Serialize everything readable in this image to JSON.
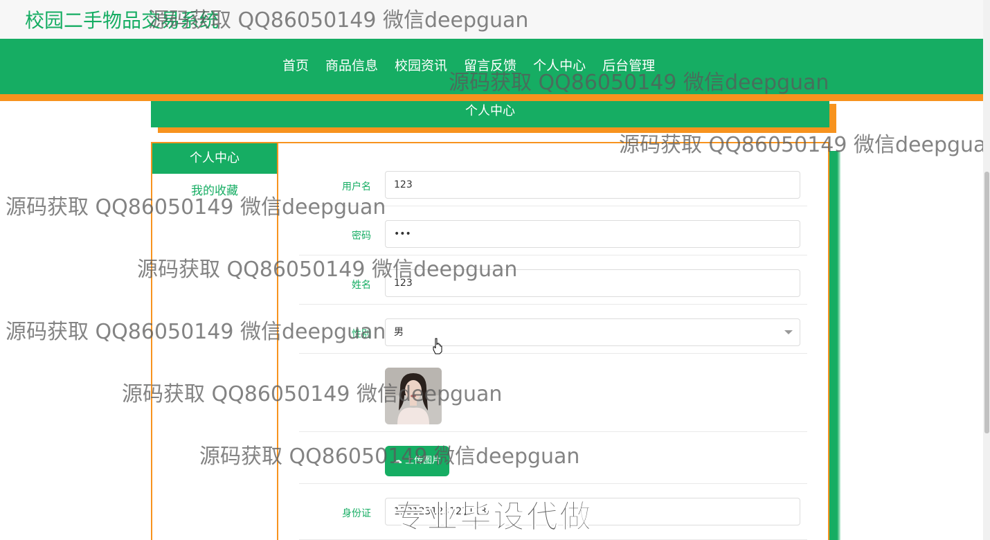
{
  "site": {
    "title": "校园二手物品交易系统"
  },
  "nav": {
    "items": [
      {
        "label": "首页"
      },
      {
        "label": "商品信息"
      },
      {
        "label": "校园资讯"
      },
      {
        "label": "留言反馈"
      },
      {
        "label": "个人中心"
      },
      {
        "label": "后台管理"
      }
    ]
  },
  "section": {
    "title": "个人中心"
  },
  "sidebar": {
    "title": "个人中心",
    "items": [
      {
        "label": "我的收藏"
      }
    ]
  },
  "form": {
    "username": {
      "label": "用户名",
      "value": "123"
    },
    "password": {
      "label": "密码",
      "value": "•••"
    },
    "name": {
      "label": "姓名",
      "value": "123"
    },
    "gender": {
      "label": "性别",
      "value": "男"
    },
    "upload": {
      "label": "上传图片"
    },
    "idcard": {
      "label": "身份证",
      "value": "123123123123123"
    }
  },
  "watermarks": {
    "text": "源码获取 QQ86050149 微信deepguan",
    "big_text": "专业毕设代做"
  },
  "colors": {
    "primary": "#16ad63",
    "accent": "#f7931e"
  }
}
